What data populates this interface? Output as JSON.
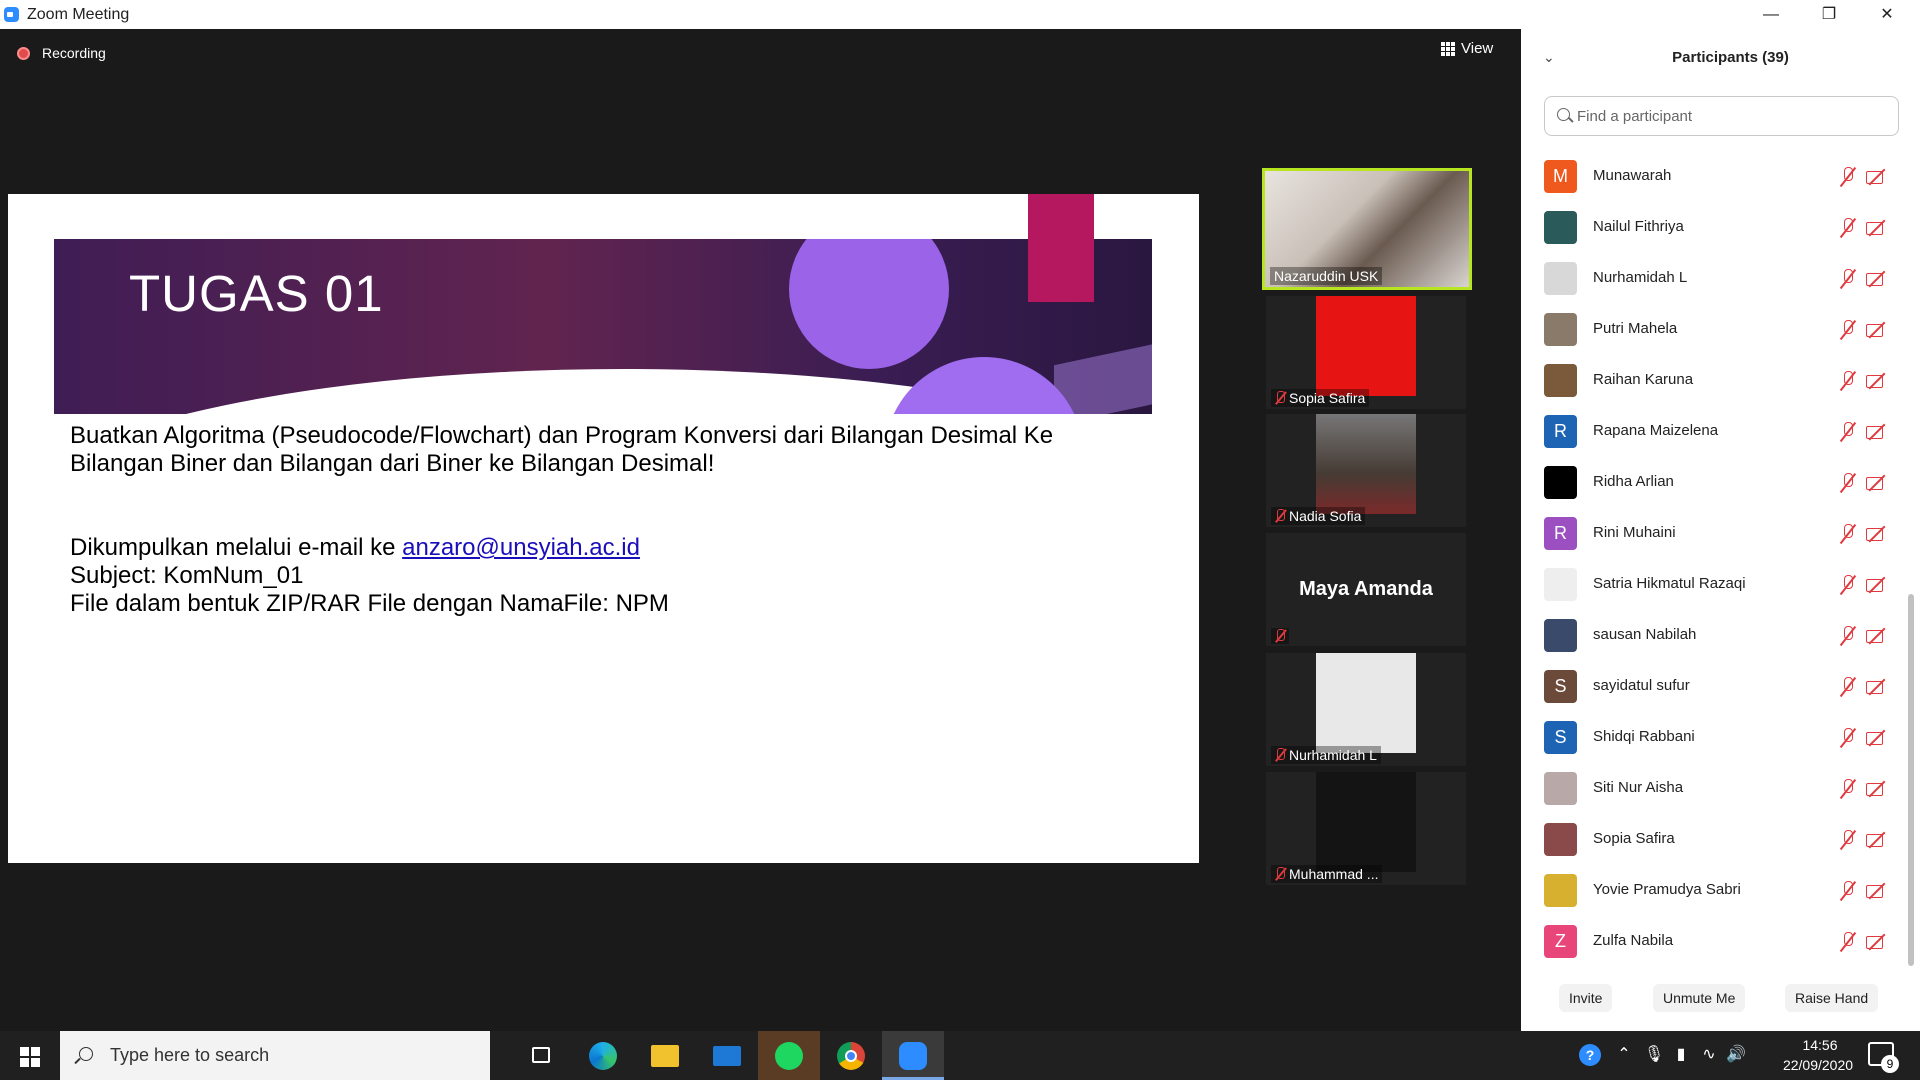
{
  "window": {
    "title": "Zoom Meeting"
  },
  "meeting": {
    "recording_label": "Recording",
    "view_label": "View"
  },
  "slide": {
    "title": "TUGAS 01",
    "line1": "Buatkan Algoritma (Pseudocode/Flowchart) dan Program Konversi dari Bilangan Desimal Ke",
    "line2": "Bilangan Biner dan Bilangan dari Biner ke Bilangan Desimal!",
    "line3_prefix": "Dikumpulkan melalui e-mail ke ",
    "line3_link": "anzaro@unsyiah.ac.id",
    "line4": "Subject: KomNum_01",
    "line5": "File dalam bentuk ZIP/RAR File dengan NamaFile: NPM",
    "colors": {
      "banner_dark": "#3f1d55",
      "banner_mid": "#61244f",
      "accent_pink": "#b5185f",
      "accent_purple": "#9b63e8"
    }
  },
  "video_tiles": [
    {
      "name": "Nazaruddin USK",
      "active_speaker": true,
      "muted": false
    },
    {
      "name": "Sopia Safira",
      "muted": true
    },
    {
      "name": "Nadia Sofia",
      "muted": true
    },
    {
      "name": "",
      "display_text": "Maya Amanda",
      "muted": true
    },
    {
      "name": "Nurhamidah L",
      "muted": true
    },
    {
      "name": "Muhammad ...",
      "muted": true
    }
  ],
  "participants": {
    "title": "Participants (39)",
    "search_placeholder": "Find a participant",
    "list": [
      {
        "name": "Munawarah",
        "initial": "M",
        "color": "#f0591e"
      },
      {
        "name": "Nailul Fithriya",
        "initial": "",
        "color": "#2a5a5a"
      },
      {
        "name": "Nurhamidah L",
        "initial": "",
        "color": "#d8d8d8"
      },
      {
        "name": "Putri Mahela",
        "initial": "",
        "color": "#8a7a6a"
      },
      {
        "name": "Raihan Karuna",
        "initial": "",
        "color": "#7a5a3a"
      },
      {
        "name": "Rapana Maizelena",
        "initial": "R",
        "color": "#1e64b4"
      },
      {
        "name": "Ridha Arlian",
        "initial": "",
        "color": "#000000"
      },
      {
        "name": "Rini Muhaini",
        "initial": "R",
        "color": "#9b4fc0"
      },
      {
        "name": "Satria Hikmatul Razaqi",
        "initial": "",
        "color": "#eeeeee"
      },
      {
        "name": "sausan Nabilah",
        "initial": "",
        "color": "#3a4a6a"
      },
      {
        "name": "sayidatul sufur",
        "initial": "S",
        "color": "#6b4a3a"
      },
      {
        "name": "Shidqi Rabbani",
        "initial": "S",
        "color": "#1e64b4"
      },
      {
        "name": "Siti Nur Aisha",
        "initial": "",
        "color": "#b8a8a8"
      },
      {
        "name": "Sopia Safira",
        "initial": "",
        "color": "#8a4a4a"
      },
      {
        "name": "Yovie Pramudya Sabri",
        "initial": "",
        "color": "#d8b030"
      },
      {
        "name": "Zulfa Nabila",
        "initial": "Z",
        "color": "#e8457a"
      }
    ],
    "buttons": {
      "invite": "Invite",
      "unmute": "Unmute Me",
      "raise_hand": "Raise Hand"
    }
  },
  "taskbar": {
    "search_placeholder": "Type here to search",
    "apps": [
      "task-view",
      "edge",
      "file-explorer",
      "mail",
      "spotify",
      "chrome",
      "zoom"
    ],
    "tray_help": "?",
    "time": "14:56",
    "date": "22/09/2020",
    "notification_count": "9"
  }
}
